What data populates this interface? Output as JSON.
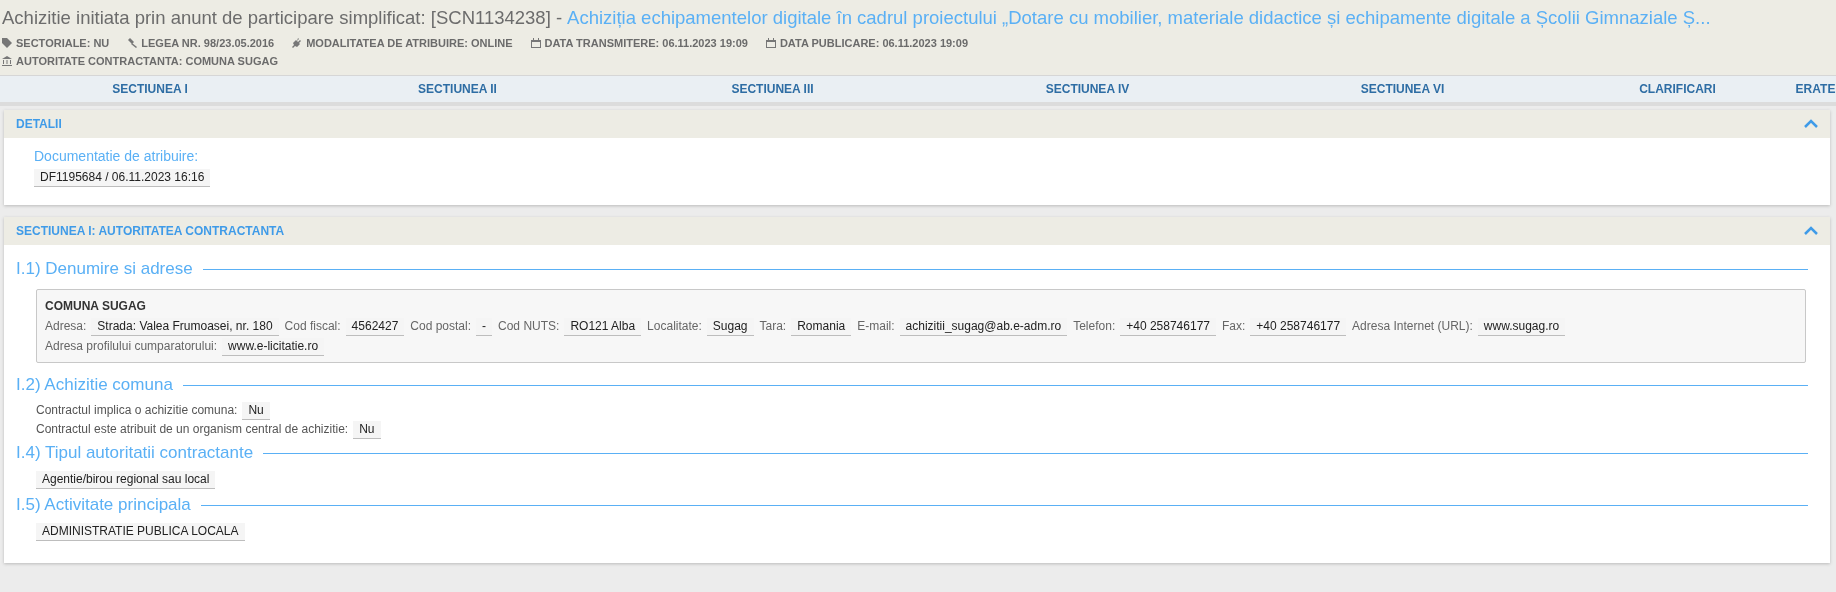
{
  "header": {
    "title": "Achizitie initiata prin anunt de participare simplificat: [SCN1134238] -",
    "subject": "Achiziția echipamentelor digitale în cadrul proiectului „Dotare cu mobilier, materiale didactice și echipamente digitale a Școlii Gimnaziale Ș...",
    "meta": [
      {
        "kind": "tag",
        "text": "SECTORIALE: NU"
      },
      {
        "kind": "gavel",
        "text": "LEGEA NR. 98/23.05.2016"
      },
      {
        "kind": "plug",
        "text": "MODALITATEA DE ATRIBUIRE: ONLINE"
      },
      {
        "kind": "calendar",
        "text": "DATA TRANSMITERE: 06.11.2023 19:09"
      },
      {
        "kind": "calendar",
        "text": "DATA PUBLICARE: 06.11.2023 19:09"
      },
      {
        "kind": "institution",
        "text": "AUTORITATE CONTRACTANTA: COMUNA SUGAG"
      }
    ]
  },
  "tabs": [
    "SECTIUNEA I",
    "SECTIUNEA II",
    "SECTIUNEA III",
    "SECTIUNEA IV",
    "SECTIUNEA VI",
    "CLARIFICARI",
    "ERATE"
  ],
  "details": {
    "title": "DETALII",
    "expanded": true,
    "label": "Documentatie de atribuire:",
    "value": "DF1195684 / 06.11.2023 16:16"
  },
  "section": {
    "title": "SECTIUNEA I: AUTORITATEA CONTRACTANTA",
    "expanded": true,
    "name_address": {
      "heading": "I.1) Denumire si adrese",
      "name": "COMUNA SUGAG",
      "fields": [
        {
          "label": "Adresa:",
          "value": "Strada: Valea Frumoasei, nr. 180"
        },
        {
          "label": "Cod fiscal:",
          "value": "4562427"
        },
        {
          "label": "Cod postal:",
          "value": "-"
        },
        {
          "label": "Cod NUTS:",
          "value": "RO121 Alba"
        },
        {
          "label": "Localitate:",
          "value": "Sugag"
        },
        {
          "label": "Tara:",
          "value": "Romania"
        },
        {
          "label": "E-mail:",
          "value": "achizitii_sugag@ab.e-adm.ro"
        },
        {
          "label": "Telefon:",
          "value": "+40 258746177"
        },
        {
          "label": "Fax:",
          "value": "+40 258746177"
        },
        {
          "label": "Adresa Internet (URL):",
          "value": "www.sugag.ro"
        },
        {
          "label": "Adresa profilului cumparatorului:",
          "value": "www.e-licitatie.ro"
        }
      ]
    },
    "joint": {
      "heading": "I.2) Achizitie comuna",
      "rows": [
        {
          "label": "Contractul implica o achizitie comuna:",
          "value": "Nu"
        },
        {
          "label": "Contractul este atribuit de un organism central de achizitie:",
          "value": "Nu"
        }
      ]
    },
    "type": {
      "heading": "I.4) Tipul autoritatii contractante",
      "value": "Agentie/birou regional sau local"
    },
    "activity": {
      "heading": "I.5) Activitate principala",
      "value": "ADMINISTRATIE PUBLICA LOCALA"
    }
  }
}
